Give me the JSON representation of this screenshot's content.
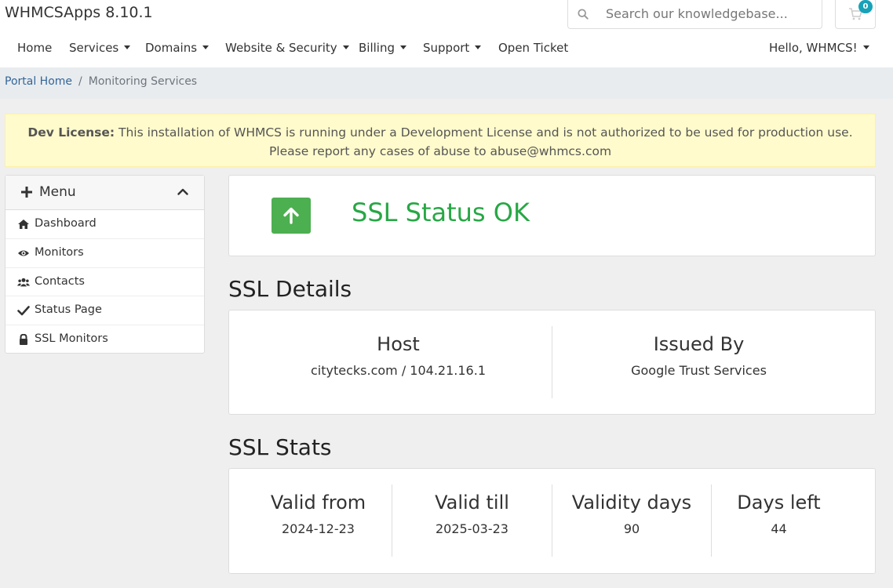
{
  "brand": "WHMCSApps 8.10.1",
  "search": {
    "placeholder": "Search our knowledgebase..."
  },
  "cart": {
    "count": "0"
  },
  "nav": {
    "home": "Home",
    "services": "Services",
    "domains": "Domains",
    "website_security": "Website & Security",
    "billing": "Billing",
    "support": "Support",
    "open_ticket": "Open Ticket",
    "user": "Hello, WHMCS!"
  },
  "breadcrumb": {
    "home": "Portal Home",
    "separator": "/",
    "current": "Monitoring Services"
  },
  "alert": {
    "label": "Dev License:",
    "line1": "This installation of WHMCS is running under a Development License and is not authorized to be used for production use.",
    "line2": "Please report any cases of abuse to abuse@whmcs.com"
  },
  "sidebar": {
    "title": "Menu",
    "items": [
      {
        "label": "Dashboard",
        "icon": "home-icon"
      },
      {
        "label": "Monitors",
        "icon": "eye-icon"
      },
      {
        "label": "Contacts",
        "icon": "users-icon"
      },
      {
        "label": "Status Page",
        "icon": "check-icon"
      },
      {
        "label": "SSL Monitors",
        "icon": "lock-icon"
      }
    ]
  },
  "status": {
    "text": "SSL Status OK",
    "color": "#28a745",
    "icon": "arrow-up-icon"
  },
  "details": {
    "title": "SSL Details",
    "host_label": "Host",
    "host_value": "citytecks.com / 104.21.16.1",
    "issuer_label": "Issued By",
    "issuer_value": "Google Trust Services"
  },
  "stats": {
    "title": "SSL Stats",
    "valid_from_label": "Valid from",
    "valid_from": "2024-12-23",
    "valid_till_label": "Valid till",
    "valid_till": "2025-03-23",
    "validity_days_label": "Validity days",
    "validity_days": "90",
    "days_left_label": "Days left",
    "days_left": "44"
  }
}
